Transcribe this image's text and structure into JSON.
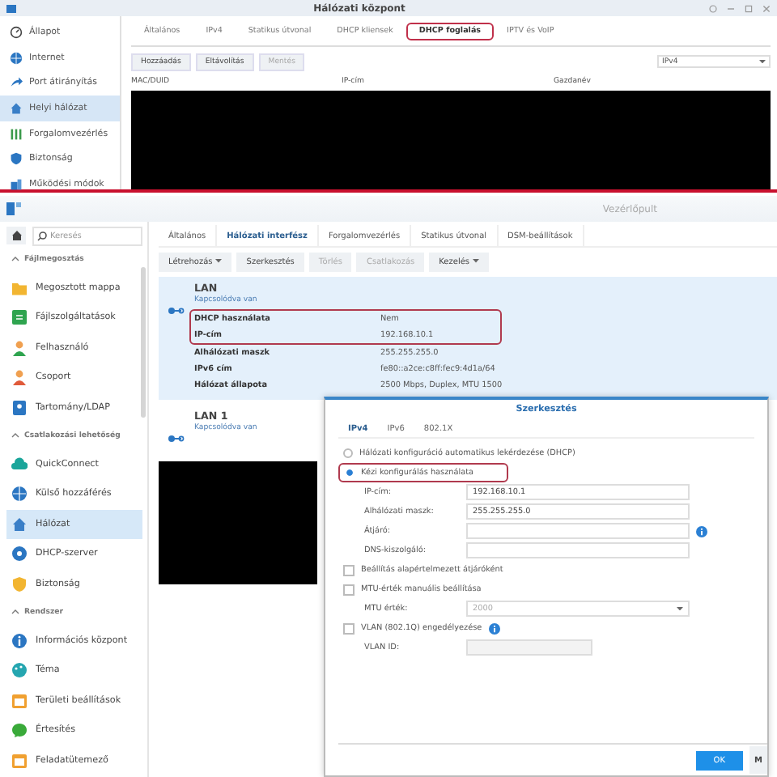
{
  "top_window": {
    "title": "Hálózati központ",
    "sidebar": [
      {
        "label": "Állapot",
        "kind": "gauge",
        "selected": false
      },
      {
        "label": "Internet",
        "kind": "globe",
        "selected": false
      },
      {
        "label": "Port átirányítás",
        "kind": "arrow",
        "selected": false
      },
      {
        "label": "Helyi hálózat",
        "kind": "house",
        "selected": true
      },
      {
        "label": "Forgalomvezérlés",
        "kind": "sliders",
        "selected": false
      },
      {
        "label": "Biztonság",
        "kind": "shield",
        "selected": false
      },
      {
        "label": "Működési módok",
        "kind": "devices",
        "selected": false
      }
    ],
    "tabs": [
      {
        "label": "Általános",
        "selected": false,
        "highlighted": false
      },
      {
        "label": "IPv4",
        "selected": false,
        "highlighted": false
      },
      {
        "label": "Statikus útvonal",
        "selected": false,
        "highlighted": false
      },
      {
        "label": "DHCP kliensek",
        "selected": false,
        "highlighted": false
      },
      {
        "label": "DHCP foglalás",
        "selected": true,
        "highlighted": true
      },
      {
        "label": "IPTV és VoIP",
        "selected": false,
        "highlighted": false
      }
    ],
    "toolbar": [
      {
        "label": "Hozzáadás",
        "disabled": false
      },
      {
        "label": "Eltávolítás",
        "disabled": false
      },
      {
        "label": "Mentés",
        "disabled": true
      }
    ],
    "filter": {
      "value": "IPv4"
    },
    "table": {
      "columns": [
        "MAC/DUID",
        "IP-cím",
        "Gazdanév"
      ]
    }
  },
  "bottom_window": {
    "title": "Vezérlőpult",
    "search": {
      "placeholder": "Keresés"
    },
    "sidebar": [
      {
        "section": "Fájlmegosztás",
        "expanded": true,
        "items": [
          {
            "label": "Megosztott mappa",
            "kind": "folder",
            "selected": false
          },
          {
            "label": "Fájlszolgáltatások",
            "kind": "document",
            "selected": false
          },
          {
            "label": "Felhasználó",
            "kind": "user",
            "selected": false
          },
          {
            "label": "Csoport",
            "kind": "group",
            "selected": false
          },
          {
            "label": "Tartomány/LDAP",
            "kind": "card",
            "selected": false
          }
        ]
      },
      {
        "section": "Csatlakozási lehetőség",
        "expanded": true,
        "items": [
          {
            "label": "QuickConnect",
            "kind": "cloud",
            "selected": false
          },
          {
            "label": "Külső hozzáférés",
            "kind": "globe",
            "selected": false
          },
          {
            "label": "Hálózat",
            "kind": "house",
            "selected": true
          },
          {
            "label": "DHCP-szerver",
            "kind": "disc",
            "selected": false
          },
          {
            "label": "Biztonság",
            "kind": "badge",
            "selected": false
          }
        ]
      },
      {
        "section": "Rendszer",
        "expanded": true,
        "items": [
          {
            "label": "Információs központ",
            "kind": "info",
            "selected": false
          },
          {
            "label": "Téma",
            "kind": "palette",
            "selected": false
          },
          {
            "label": "Területi beállítások",
            "kind": "calendar",
            "selected": false
          },
          {
            "label": "Értesítés",
            "kind": "chat",
            "selected": false
          },
          {
            "label": "Feladatütemező",
            "kind": "calendar",
            "selected": false
          }
        ]
      }
    ],
    "tabs": [
      {
        "label": "Általános",
        "selected": false
      },
      {
        "label": "Hálózati interfész",
        "selected": true
      },
      {
        "label": "Forgalomvezérlés",
        "selected": false
      },
      {
        "label": "Statikus útvonal",
        "selected": false
      },
      {
        "label": "DSM-beállítások",
        "selected": false
      }
    ],
    "toolbar": [
      {
        "label": "Létrehozás",
        "disabled": false,
        "dropdown": true
      },
      {
        "label": "Szerkesztés",
        "disabled": false,
        "dropdown": false
      },
      {
        "label": "Törlés",
        "disabled": true,
        "dropdown": false
      },
      {
        "label": "Csatlakozás",
        "disabled": true,
        "dropdown": false
      },
      {
        "label": "Kezelés",
        "disabled": false,
        "dropdown": true
      }
    ],
    "interfaces": [
      {
        "name": "LAN",
        "status": "Kapcsolódva van",
        "selected": true,
        "rows": [
          {
            "label": "DHCP használata",
            "value": "Nem",
            "highlighted": true
          },
          {
            "label": "IP-cím",
            "value": "192.168.10.1",
            "highlighted": true
          },
          {
            "label": "Alhálózati maszk",
            "value": "255.255.255.0",
            "highlighted": false
          },
          {
            "label": "IPv6 cím",
            "value": "fe80::a2ce:c8ff:fec9:4d1a/64",
            "highlighted": false
          },
          {
            "label": "Hálózat állapota",
            "value": "2500 Mbps, Duplex, MTU 1500",
            "highlighted": false
          }
        ]
      },
      {
        "name": "LAN 1",
        "status": "Kapcsolódva van",
        "selected": false,
        "redacted": true
      }
    ],
    "dialog": {
      "title": "Szerkesztés",
      "tabs": [
        {
          "label": "IPv4",
          "selected": true
        },
        {
          "label": "IPv6",
          "selected": false
        },
        {
          "label": "802.1X",
          "selected": false
        }
      ],
      "rows": [
        {
          "kind": "radio",
          "label": "Hálózati konfiguráció automatikus lekérdezése (DHCP)",
          "selected": false,
          "highlighted": false
        },
        {
          "kind": "radio",
          "label": "Kézi konfigurálás használata",
          "selected": true,
          "highlighted": true
        },
        {
          "kind": "field",
          "label": "IP-cím:",
          "value": "192.168.10.1",
          "disabled": false,
          "info": false
        },
        {
          "kind": "field",
          "label": "Alhálózati maszk:",
          "value": "255.255.255.0",
          "disabled": false,
          "info": false
        },
        {
          "kind": "field",
          "label": "Átjáró:",
          "disabled": false,
          "info": true
        },
        {
          "kind": "field",
          "label": "DNS-kiszolgáló:",
          "disabled": false,
          "info": false
        },
        {
          "kind": "checkbox",
          "label": "Beállítás alapértelmezett átjáróként",
          "checked": false,
          "info": false
        },
        {
          "kind": "checkbox",
          "label": "MTU-érték manuális beállítása",
          "checked": false,
          "info": false
        },
        {
          "kind": "select",
          "label": "MTU érték:",
          "value": "2000",
          "disabled": true
        },
        {
          "kind": "checkbox",
          "label": "VLAN (802.1Q) engedélyezése",
          "checked": false,
          "info": true
        },
        {
          "kind": "field",
          "label": "VLAN ID:",
          "disabled": true,
          "info": false
        }
      ],
      "buttons": [
        {
          "label": "OK",
          "primary": true
        },
        {
          "label": "M",
          "primary": false
        }
      ]
    }
  }
}
